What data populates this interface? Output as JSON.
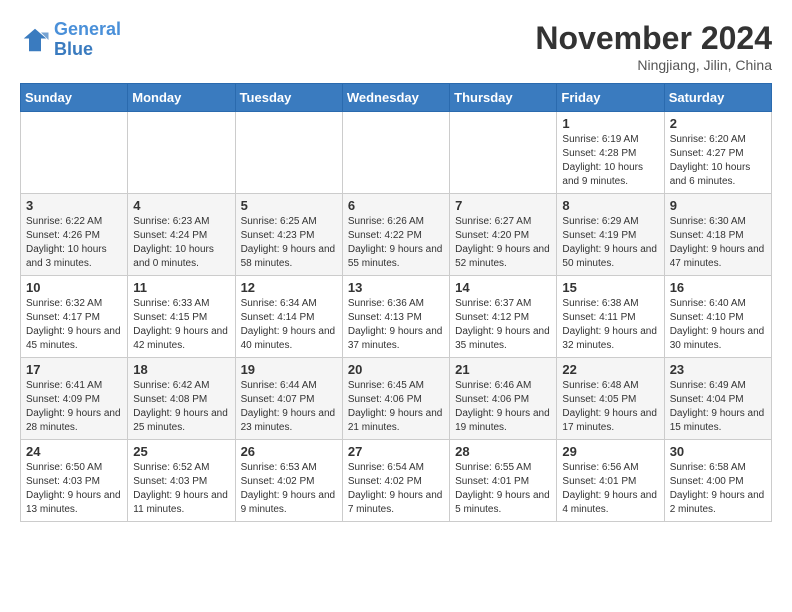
{
  "logo": {
    "line1": "General",
    "line2": "Blue"
  },
  "title": "November 2024",
  "subtitle": "Ningjiang, Jilin, China",
  "days_of_week": [
    "Sunday",
    "Monday",
    "Tuesday",
    "Wednesday",
    "Thursday",
    "Friday",
    "Saturday"
  ],
  "weeks": [
    [
      {
        "day": "",
        "info": ""
      },
      {
        "day": "",
        "info": ""
      },
      {
        "day": "",
        "info": ""
      },
      {
        "day": "",
        "info": ""
      },
      {
        "day": "",
        "info": ""
      },
      {
        "day": "1",
        "info": "Sunrise: 6:19 AM\nSunset: 4:28 PM\nDaylight: 10 hours and 9 minutes."
      },
      {
        "day": "2",
        "info": "Sunrise: 6:20 AM\nSunset: 4:27 PM\nDaylight: 10 hours and 6 minutes."
      }
    ],
    [
      {
        "day": "3",
        "info": "Sunrise: 6:22 AM\nSunset: 4:26 PM\nDaylight: 10 hours and 3 minutes."
      },
      {
        "day": "4",
        "info": "Sunrise: 6:23 AM\nSunset: 4:24 PM\nDaylight: 10 hours and 0 minutes."
      },
      {
        "day": "5",
        "info": "Sunrise: 6:25 AM\nSunset: 4:23 PM\nDaylight: 9 hours and 58 minutes."
      },
      {
        "day": "6",
        "info": "Sunrise: 6:26 AM\nSunset: 4:22 PM\nDaylight: 9 hours and 55 minutes."
      },
      {
        "day": "7",
        "info": "Sunrise: 6:27 AM\nSunset: 4:20 PM\nDaylight: 9 hours and 52 minutes."
      },
      {
        "day": "8",
        "info": "Sunrise: 6:29 AM\nSunset: 4:19 PM\nDaylight: 9 hours and 50 minutes."
      },
      {
        "day": "9",
        "info": "Sunrise: 6:30 AM\nSunset: 4:18 PM\nDaylight: 9 hours and 47 minutes."
      }
    ],
    [
      {
        "day": "10",
        "info": "Sunrise: 6:32 AM\nSunset: 4:17 PM\nDaylight: 9 hours and 45 minutes."
      },
      {
        "day": "11",
        "info": "Sunrise: 6:33 AM\nSunset: 4:15 PM\nDaylight: 9 hours and 42 minutes."
      },
      {
        "day": "12",
        "info": "Sunrise: 6:34 AM\nSunset: 4:14 PM\nDaylight: 9 hours and 40 minutes."
      },
      {
        "day": "13",
        "info": "Sunrise: 6:36 AM\nSunset: 4:13 PM\nDaylight: 9 hours and 37 minutes."
      },
      {
        "day": "14",
        "info": "Sunrise: 6:37 AM\nSunset: 4:12 PM\nDaylight: 9 hours and 35 minutes."
      },
      {
        "day": "15",
        "info": "Sunrise: 6:38 AM\nSunset: 4:11 PM\nDaylight: 9 hours and 32 minutes."
      },
      {
        "day": "16",
        "info": "Sunrise: 6:40 AM\nSunset: 4:10 PM\nDaylight: 9 hours and 30 minutes."
      }
    ],
    [
      {
        "day": "17",
        "info": "Sunrise: 6:41 AM\nSunset: 4:09 PM\nDaylight: 9 hours and 28 minutes."
      },
      {
        "day": "18",
        "info": "Sunrise: 6:42 AM\nSunset: 4:08 PM\nDaylight: 9 hours and 25 minutes."
      },
      {
        "day": "19",
        "info": "Sunrise: 6:44 AM\nSunset: 4:07 PM\nDaylight: 9 hours and 23 minutes."
      },
      {
        "day": "20",
        "info": "Sunrise: 6:45 AM\nSunset: 4:06 PM\nDaylight: 9 hours and 21 minutes."
      },
      {
        "day": "21",
        "info": "Sunrise: 6:46 AM\nSunset: 4:06 PM\nDaylight: 9 hours and 19 minutes."
      },
      {
        "day": "22",
        "info": "Sunrise: 6:48 AM\nSunset: 4:05 PM\nDaylight: 9 hours and 17 minutes."
      },
      {
        "day": "23",
        "info": "Sunrise: 6:49 AM\nSunset: 4:04 PM\nDaylight: 9 hours and 15 minutes."
      }
    ],
    [
      {
        "day": "24",
        "info": "Sunrise: 6:50 AM\nSunset: 4:03 PM\nDaylight: 9 hours and 13 minutes."
      },
      {
        "day": "25",
        "info": "Sunrise: 6:52 AM\nSunset: 4:03 PM\nDaylight: 9 hours and 11 minutes."
      },
      {
        "day": "26",
        "info": "Sunrise: 6:53 AM\nSunset: 4:02 PM\nDaylight: 9 hours and 9 minutes."
      },
      {
        "day": "27",
        "info": "Sunrise: 6:54 AM\nSunset: 4:02 PM\nDaylight: 9 hours and 7 minutes."
      },
      {
        "day": "28",
        "info": "Sunrise: 6:55 AM\nSunset: 4:01 PM\nDaylight: 9 hours and 5 minutes."
      },
      {
        "day": "29",
        "info": "Sunrise: 6:56 AM\nSunset: 4:01 PM\nDaylight: 9 hours and 4 minutes."
      },
      {
        "day": "30",
        "info": "Sunrise: 6:58 AM\nSunset: 4:00 PM\nDaylight: 9 hours and 2 minutes."
      }
    ]
  ]
}
